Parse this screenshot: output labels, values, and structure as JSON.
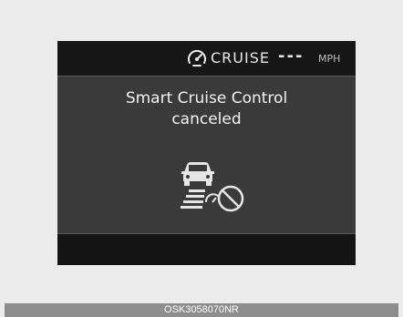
{
  "status_bar": {
    "cruise_icon": "cruise-gauge-icon",
    "cruise_label": "CRUISE",
    "set_speed": "---",
    "unit": "MPH"
  },
  "message": {
    "line1": "Smart Cruise Control",
    "line2": "canceled"
  },
  "warning_icon": "scc-canceled-icon",
  "caption": "OSK3058070NR",
  "colors": {
    "screen_bg": "#3a3a3a",
    "bar_bg": "#161616",
    "text": "#f2f2f2",
    "page_bg": "#ececec",
    "caption_bg": "#8d8d8d"
  }
}
